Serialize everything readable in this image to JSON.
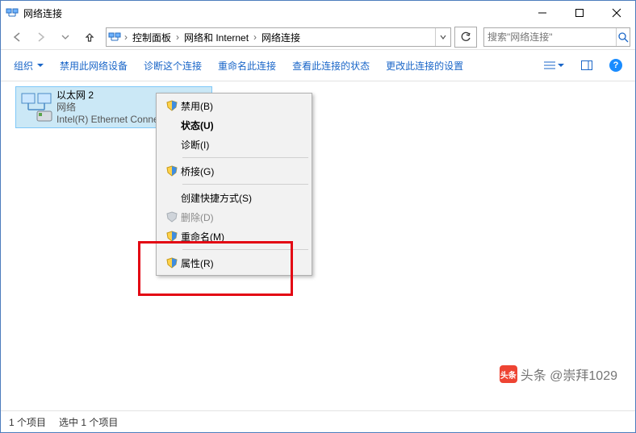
{
  "window": {
    "title": "网络连接"
  },
  "breadcrumb": {
    "level0": "控制面板",
    "level1": "网络和 Internet",
    "level2": "网络连接"
  },
  "search": {
    "placeholder": "搜索\"网络连接\""
  },
  "toolbar": {
    "organize": "组织",
    "disable": "禁用此网络设备",
    "diagnose": "诊断这个连接",
    "rename": "重命名此连接",
    "view_status": "查看此连接的状态",
    "change_settings": "更改此连接的设置"
  },
  "adapter": {
    "name": "以太网 2",
    "network": "网络",
    "device": "Intel(R) Ethernet Connection"
  },
  "context_menu": {
    "disable": "禁用(B)",
    "status": "状态(U)",
    "diagnose": "诊断(I)",
    "bridge": "桥接(G)",
    "shortcut": "创建快捷方式(S)",
    "delete": "删除(D)",
    "rename": "重命名(M)",
    "properties": "属性(R)"
  },
  "statusbar": {
    "items": "1 个项目",
    "selected": "选中 1 个项目"
  },
  "watermark": {
    "text": "头条 @崇拜1029"
  }
}
